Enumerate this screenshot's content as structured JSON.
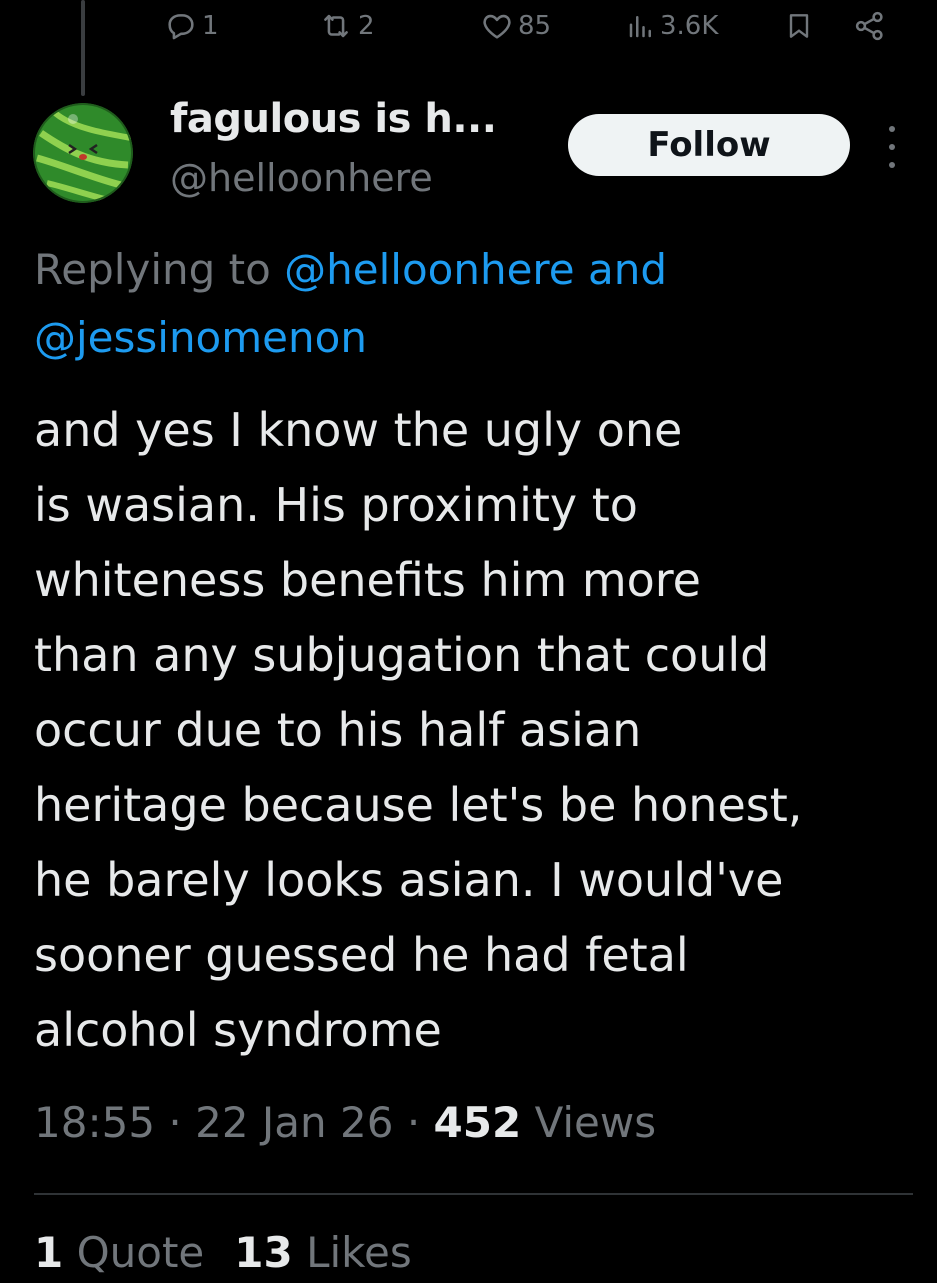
{
  "action_bar": {
    "reply_count": "1",
    "retweet_count": "2",
    "like_count": "85",
    "view_count": "3.6K"
  },
  "author": {
    "display_name": "fagulous is h...",
    "handle": "@helloonhere",
    "avatar_icon": "watermelon-avatar"
  },
  "follow_label": "Follow",
  "replying": {
    "prefix": "Replying to",
    "mention1": "@helloonhere",
    "joiner": "and",
    "mention2": "@jessinomenon"
  },
  "tweet_text": "and yes I know the ugly one\nis wasian. His proximity to\nwhiteness benefits him more\nthan any subjugation that could\noccur due to his half asian\nheritage because let's be honest,\nhe barely looks asian. I would've\nsooner guessed he had fetal\nalcohol syndrome",
  "meta": {
    "time": "18:55",
    "separator": "·",
    "date": "22 Jan 26",
    "views_count": "452",
    "views_label": "Views"
  },
  "stats": {
    "quotes_count": "1",
    "quotes_label": "Quote",
    "likes_count": "13",
    "likes_label": "Likes"
  },
  "colors": {
    "background": "#000000",
    "text": "#e7e9ea",
    "secondary": "#71767b",
    "link": "#1d9bf0",
    "follow_bg": "#eff3f4"
  }
}
